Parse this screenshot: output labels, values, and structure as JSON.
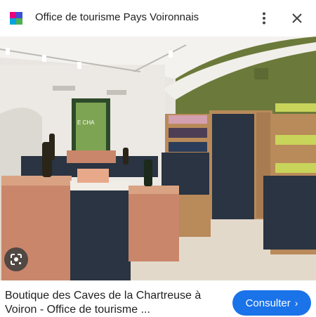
{
  "header": {
    "title": "Office de tourisme Pays Voironnais",
    "logo_icon": "office-tourisme-logo-icon",
    "more_icon": "more-vert-icon",
    "close_icon": "close-icon"
  },
  "photo": {
    "sign_text": "E CHA"
  },
  "lens": {
    "icon": "google-lens-icon"
  },
  "caption": {
    "text": "Boutique des Caves de la Chartreuse à Voiron - Office de tourisme ..."
  },
  "consult_button": {
    "label": "Consulter",
    "chevron": "›",
    "color": "#1a73e8"
  },
  "colors": {
    "wall_green": "#6b7a3a",
    "copper": "#c9866b",
    "navy_cabinet": "#2a3442",
    "wood": "#b98a5a"
  }
}
